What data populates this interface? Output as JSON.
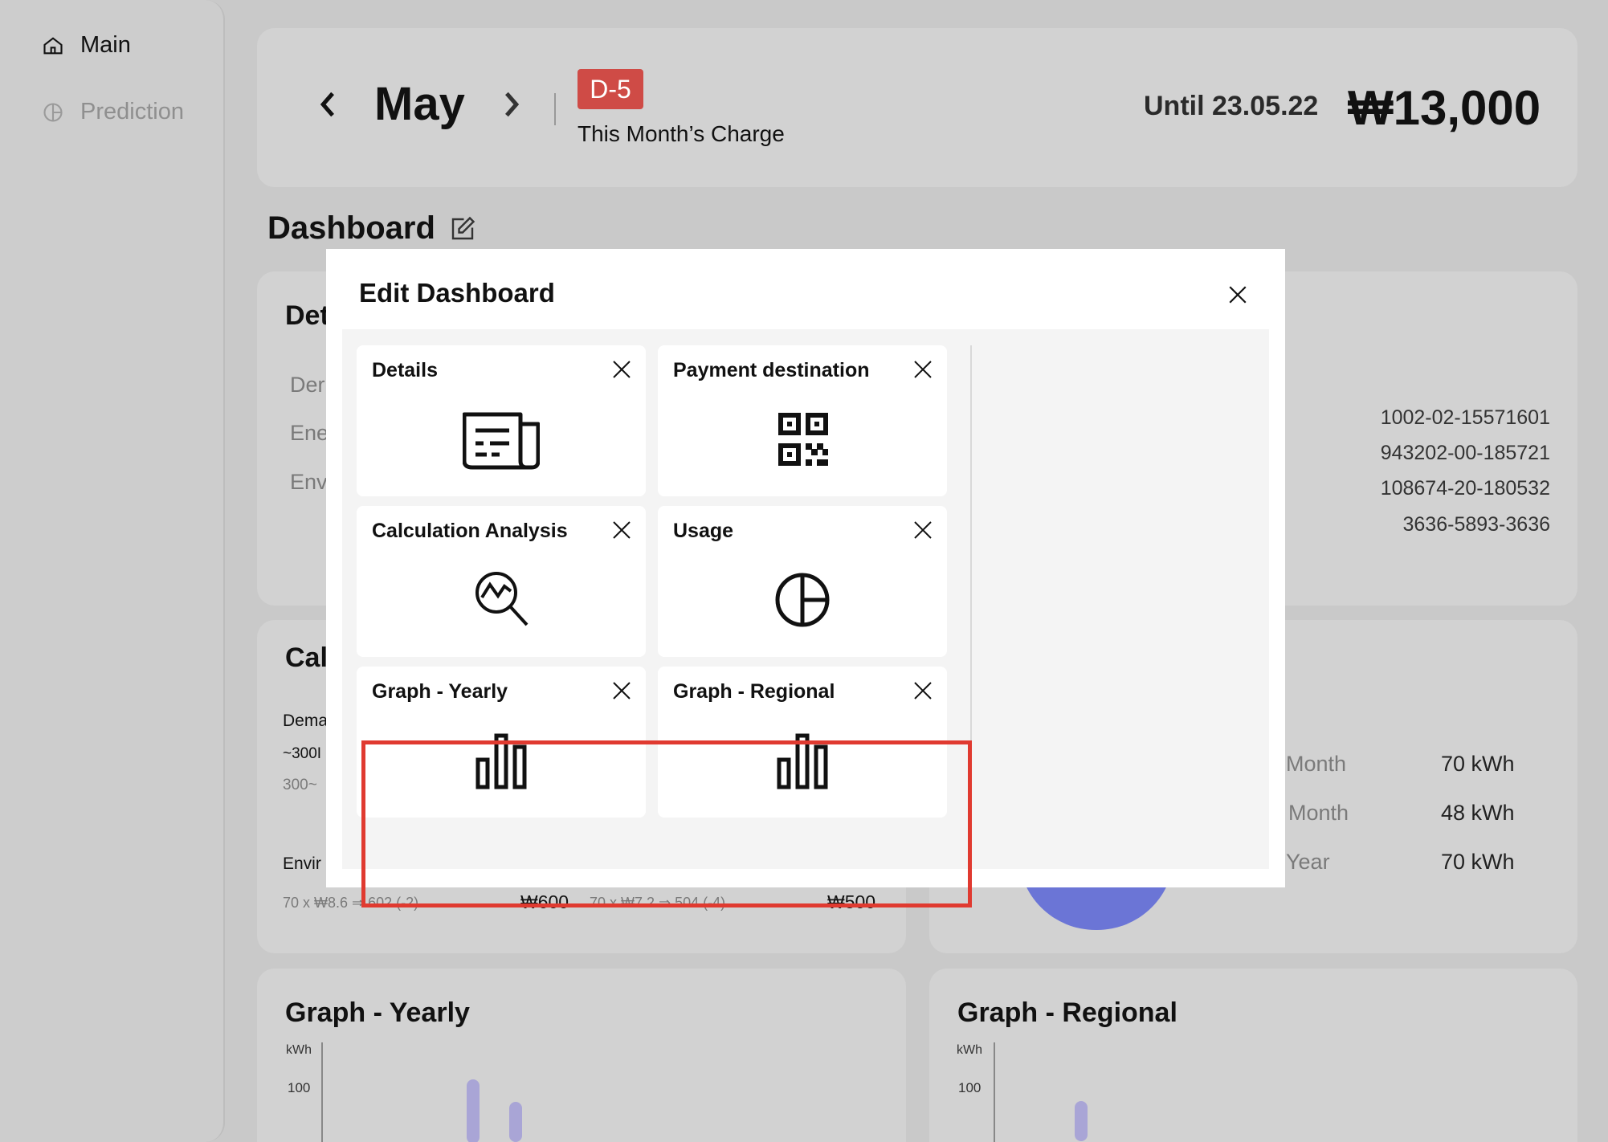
{
  "sidebar": {
    "items": [
      {
        "label": "Main",
        "icon": "home-icon"
      },
      {
        "label": "Prediction",
        "icon": "pie-icon"
      }
    ]
  },
  "header": {
    "month": "May",
    "badge": "D-5",
    "charge_label": "This Month’s Charge",
    "until": "Until 23.05.22",
    "amount": "₩13,000"
  },
  "dashboard": {
    "title": "Dashboard"
  },
  "background": {
    "details": {
      "title_fragment": "Det",
      "rows": [
        "Der",
        "Ene",
        "Env"
      ],
      "accounts": [
        "1002-02-15571601",
        "943202-00-185721",
        "108674-20-180532",
        "3636-5893-3636"
      ]
    },
    "calc": {
      "title_fragment": "Cal",
      "demand": "Dema",
      "tier1": "~300I",
      "tier2": "300~",
      "env": "Envir",
      "formula_1": "70 x ₩8.6 ⇒ 602 (-2)",
      "value_1": "₩600",
      "formula_2": "70 x ₩7.2 ⇒ 504 (-4)",
      "value_2": "₩500"
    },
    "usage": {
      "rows": [
        {
          "label": "Month",
          "value": "70 kWh"
        },
        {
          "label": "Month",
          "value": "48 kWh"
        },
        {
          "label": "Year",
          "value": "70 kWh"
        }
      ],
      "accent": "#6b75d6"
    },
    "graph_yearly": {
      "title": "Graph - Yearly",
      "unit": "kWh",
      "tick": "100"
    },
    "graph_regional": {
      "title": "Graph - Regional",
      "unit": "kWh",
      "tick": "100"
    }
  },
  "modal": {
    "title": "Edit Dashboard",
    "tiles": [
      {
        "label": "Details",
        "icon": "newspaper-icon"
      },
      {
        "label": "Payment destination",
        "icon": "qr-code-icon"
      },
      {
        "label": "Calculation Analysis",
        "icon": "analysis-search-icon"
      },
      {
        "label": "Usage",
        "icon": "pie-chart-icon"
      },
      {
        "label": "Graph - Yearly",
        "icon": "bar-chart-icon"
      },
      {
        "label": "Graph - Regional",
        "icon": "bar-chart-icon"
      }
    ],
    "highlight_color": "#e03a30"
  }
}
